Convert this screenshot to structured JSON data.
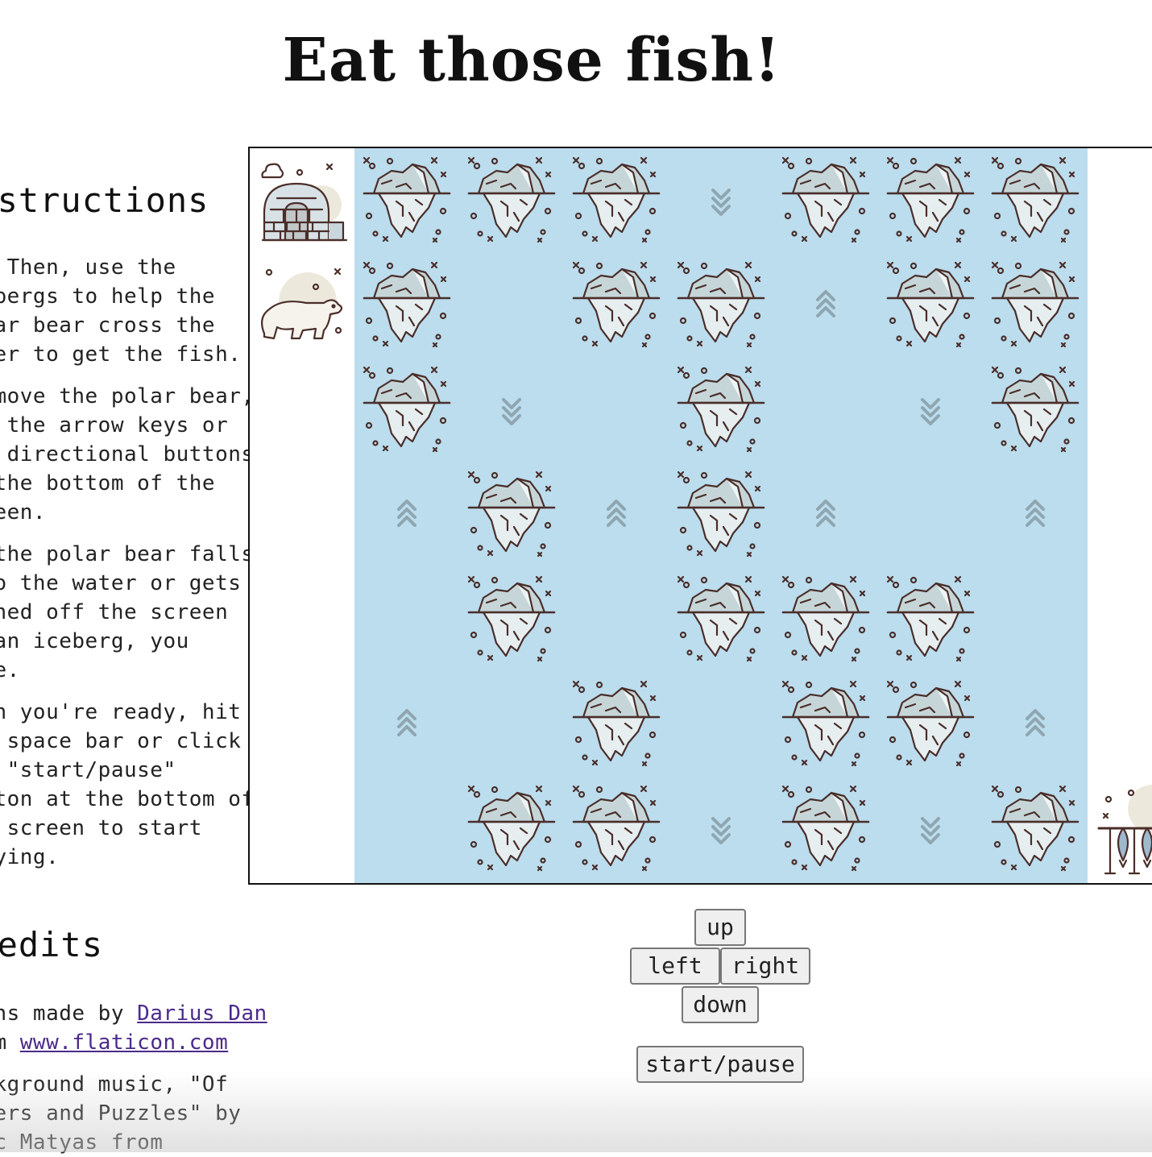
{
  "title": "Eat those fish!",
  "instructions": {
    "heading": "Instructions",
    "paragraphs": [
      [
        "Hi! Then, use the",
        "icebergs to help the",
        "polar bear cross the",
        "water to get the fish."
      ],
      [
        "To move the polar bear,",
        "use the arrow keys or",
        "the directional buttons",
        "at the bottom of the",
        "screen."
      ],
      [
        "If the polar bear falls",
        "into the water or gets",
        "pushed off the screen",
        "by an iceberg, you",
        "lose."
      ],
      [
        "When you're ready, hit",
        "the space bar or click",
        "the \"start/pause\"",
        "button at the bottom of",
        "the screen to start",
        "playing."
      ]
    ]
  },
  "credits": {
    "heading": "Credits",
    "icons_prefix": "Icons made by",
    "author_link": "Darius Dan",
    "from": "from",
    "site_link": "www.flaticon.com",
    "music_lines": [
      "Background music, \"Of",
      "Towers and Puzzles\" by",
      "Eric Matyas from"
    ]
  },
  "board": {
    "start_tile": "igloo-icon",
    "player": "polar-bear-icon",
    "goal": "fish-basket-icon",
    "lanes": [
      {
        "direction": "up",
        "cells": [
          "iceberg",
          "iceberg",
          "iceberg",
          "water",
          "water",
          "water",
          "water"
        ]
      },
      {
        "direction": "down",
        "cells": [
          "iceberg",
          "water",
          "water",
          "iceberg",
          "iceberg",
          "water",
          "iceberg"
        ]
      },
      {
        "direction": "up",
        "cells": [
          "iceberg",
          "iceberg",
          "water",
          "water",
          "water",
          "iceberg",
          "iceberg"
        ]
      },
      {
        "direction": "down",
        "cells": [
          "water",
          "iceberg",
          "iceberg",
          "iceberg",
          "iceberg",
          "water",
          "water"
        ]
      },
      {
        "direction": "up",
        "cells": [
          "iceberg",
          "water",
          "water",
          "water",
          "iceberg",
          "iceberg",
          "iceberg"
        ]
      },
      {
        "direction": "down",
        "cells": [
          "iceberg",
          "iceberg",
          "water",
          "water",
          "iceberg",
          "iceberg",
          "water"
        ]
      },
      {
        "direction": "up",
        "cells": [
          "iceberg",
          "iceberg",
          "iceberg",
          "water",
          "water",
          "water",
          "iceberg"
        ]
      }
    ],
    "colors": {
      "water": "#bbddee",
      "ice_top": "#c6d6d8",
      "ice_body": "#e6eef0",
      "outline": "#4a2e2a",
      "arrow": "#8fa6b0"
    }
  },
  "controls": {
    "up": "up",
    "left": "left",
    "right": "right",
    "down": "down",
    "start_pause": "start/pause"
  }
}
